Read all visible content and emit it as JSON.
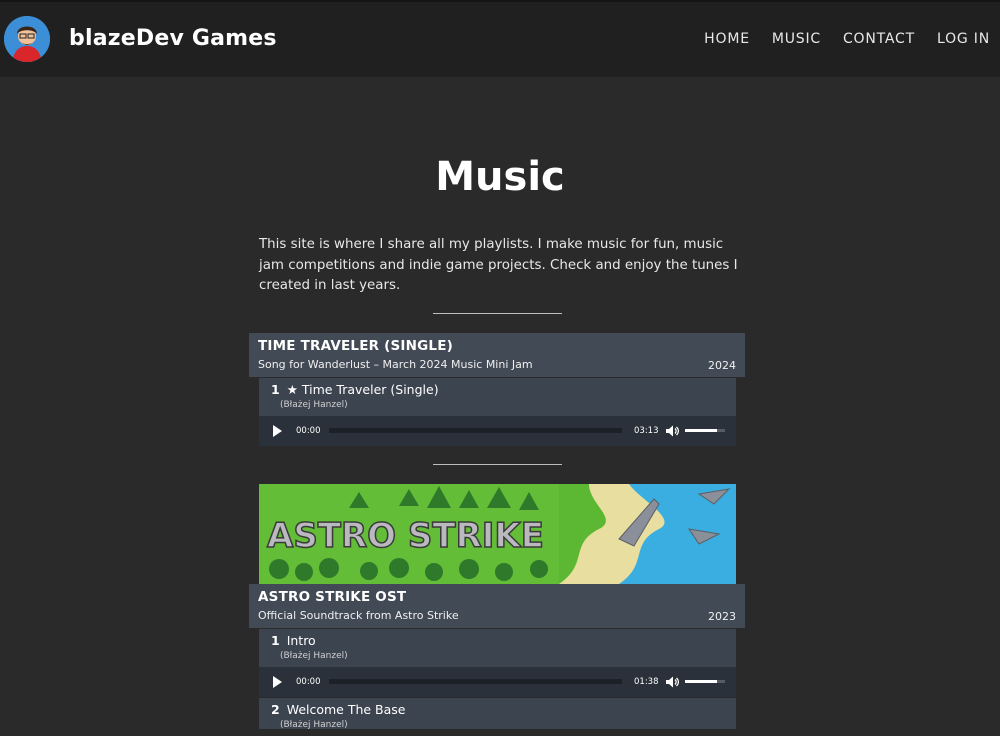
{
  "header": {
    "site_title": "blazeDev Games",
    "nav": [
      "HOME",
      "MUSIC",
      "CONTACT",
      "LOG IN"
    ]
  },
  "page": {
    "title": "Music",
    "intro": "This site is where I share all my playlists. I make music for fun, music jam competitions and indie game projects. Check and enjoy the tunes I created in last years."
  },
  "albums": [
    {
      "title": "TIME TRAVELER (SINGLE)",
      "subtitle": "Song for Wanderlust – March 2024 Music Mini Jam",
      "year": "2024",
      "tracks": [
        {
          "num": "1",
          "title": "★ Time Traveler (Single)",
          "artist": "(Błażej Hanzel)",
          "current": "00:00",
          "duration": "03:13",
          "volume": 0.8
        }
      ]
    },
    {
      "banner_text": "ASTRO STRIKE",
      "title": "ASTRO STRIKE OST",
      "subtitle": "Official Soundtrack from Astro Strike",
      "year": "2023",
      "tracks": [
        {
          "num": "1",
          "title": "Intro",
          "artist": "(Błażej Hanzel)",
          "current": "00:00",
          "duration": "01:38",
          "volume": 0.8
        },
        {
          "num": "2",
          "title": "Welcome The Base",
          "artist": "(Błażej Hanzel)"
        }
      ]
    }
  ],
  "icons": {
    "play": "play-icon",
    "volume": "volume-icon"
  },
  "colors": {
    "background": "#2a2a2a",
    "header": "#202020",
    "album_header": "#424a55",
    "track": "#3c4450",
    "player": "#2a313a"
  }
}
